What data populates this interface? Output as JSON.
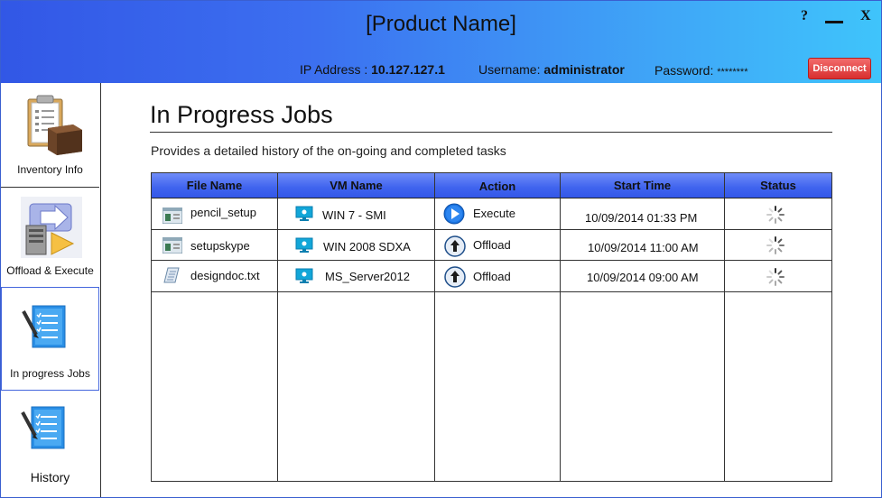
{
  "header": {
    "title": "[Product Name]",
    "help_label": "?",
    "close_label": "X",
    "ip_label": "IP Address : ",
    "ip_value": "10.127.127.1",
    "username_label": "Username: ",
    "username_value": "administrator",
    "password_label": "Password: ",
    "password_value": "********",
    "disconnect_label": "Disconnect"
  },
  "sidebar": {
    "items": [
      {
        "label": "Inventory Info",
        "icon": "clipboard-box-icon"
      },
      {
        "label": "Offload & Execute",
        "icon": "server-arrow-icon"
      },
      {
        "label": "In progress Jobs",
        "icon": "checklist-pen-icon",
        "active": true
      },
      {
        "label": "History",
        "icon": "checklist-pen-icon"
      }
    ]
  },
  "main": {
    "title": "In Progress Jobs",
    "subtitle": "Provides a detailed history of the on-going and completed tasks"
  },
  "table": {
    "headers": [
      "File Name",
      "VM Name",
      "Action",
      "Start Time",
      "Status"
    ],
    "rows": [
      {
        "file": "pencil_setup",
        "file_icon": "app-window-icon",
        "vm": "WIN 7 - SMI",
        "vm_icon": "monitor-icon",
        "action": "Execute",
        "action_icon": "play-circle-icon",
        "start": "10/09/2014 01:33 PM",
        "status_icon": "spinner-icon"
      },
      {
        "file": "setupskype",
        "file_icon": "app-window-icon",
        "vm": "WIN 2008 SDXA",
        "vm_icon": "monitor-icon",
        "action": "Offload",
        "action_icon": "upload-circle-icon",
        "start": "10/09/2014 11:00 AM",
        "status_icon": "spinner-icon"
      },
      {
        "file": "designdoc.txt",
        "file_icon": "text-file-icon",
        "vm": "MS_Server2012",
        "vm_icon": "monitor-icon",
        "action": "Offload",
        "action_icon": "upload-circle-icon",
        "start": "10/09/2014 09:00 AM",
        "status_icon": "spinner-icon"
      }
    ]
  },
  "colors": {
    "header_start": "#3257e6",
    "header_end": "#3fc4fb",
    "table_header": "#3f63ee",
    "disconnect": "#d82f2f"
  }
}
